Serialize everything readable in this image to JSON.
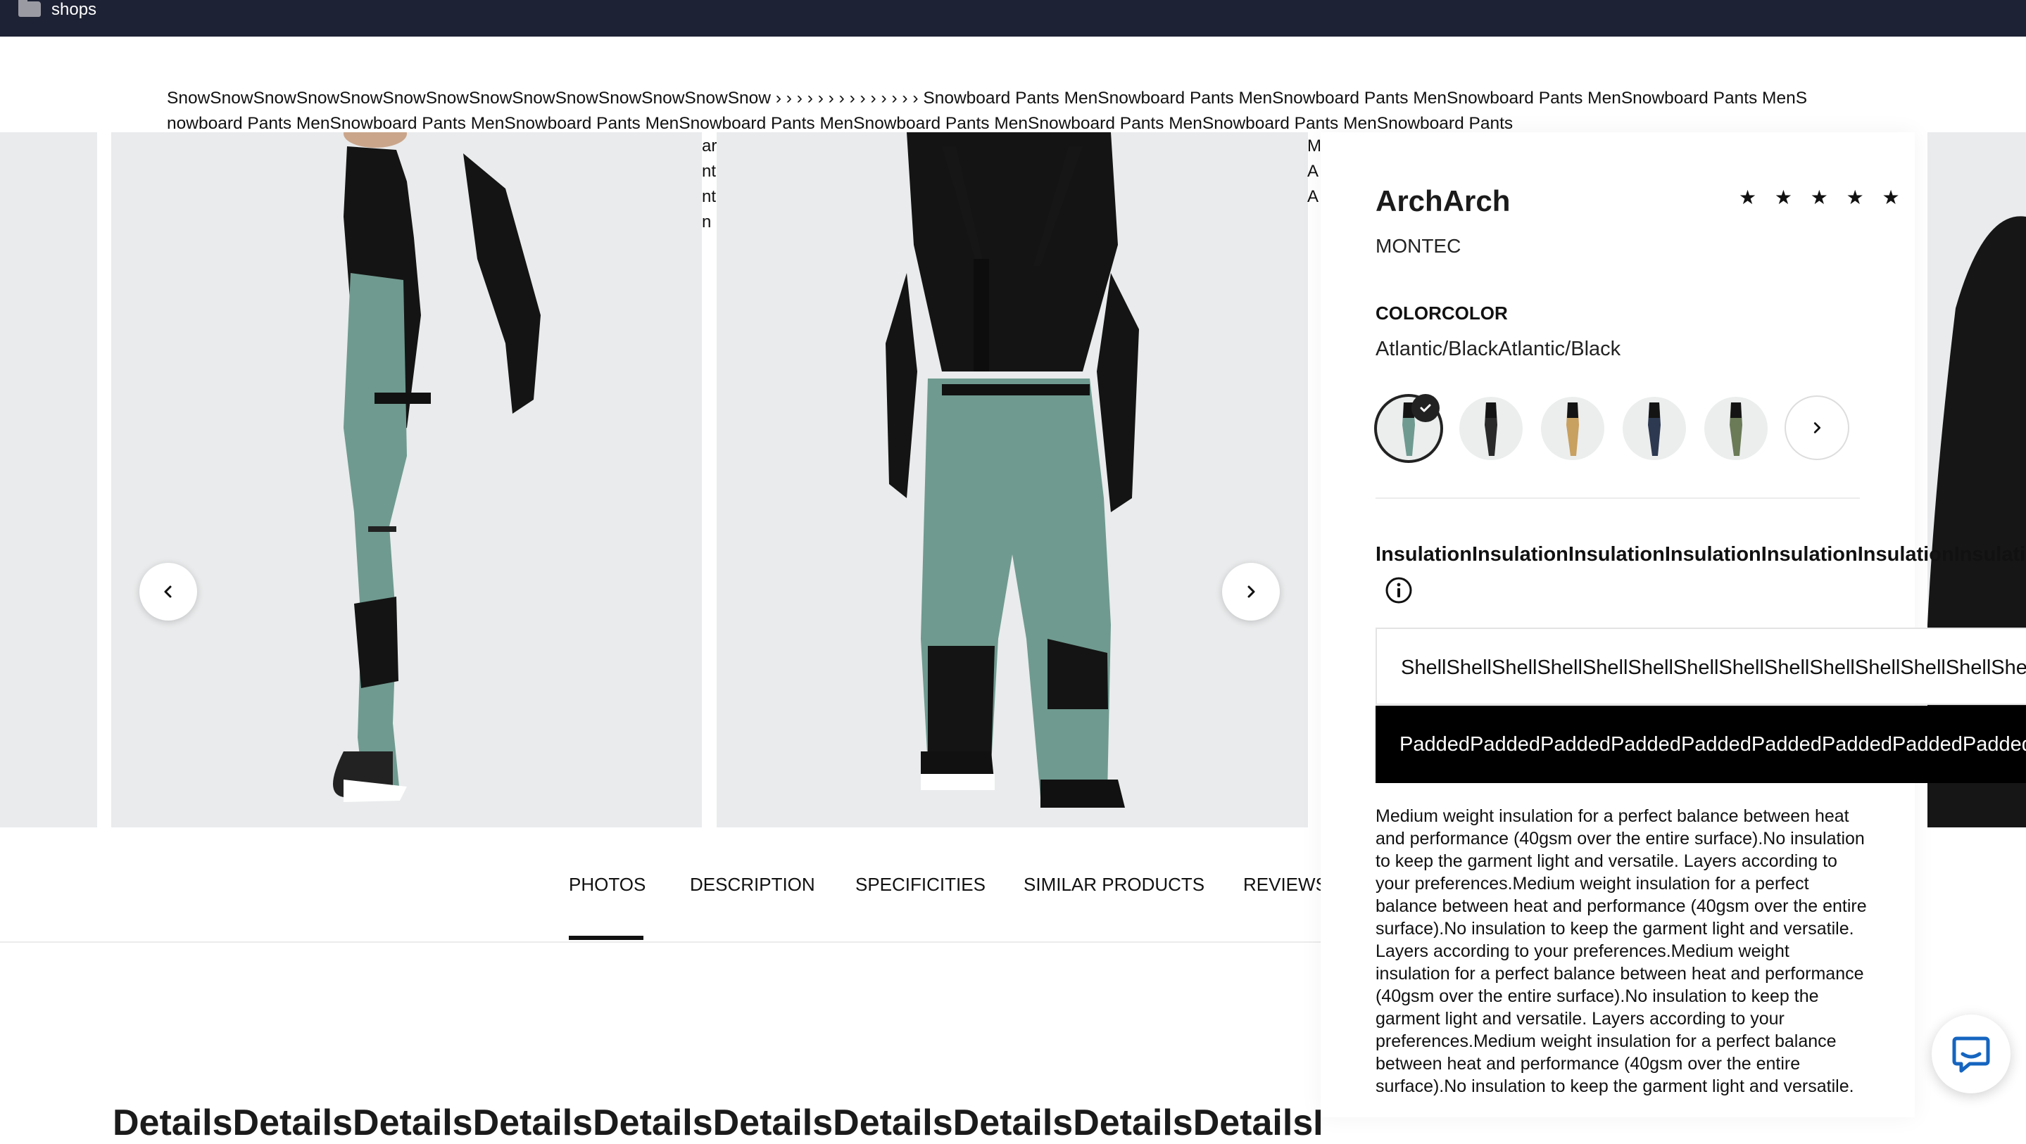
{
  "window": {
    "title": "shops"
  },
  "breadcrumb": {
    "category": "SnowSnowSnowSnowSnowSnowSnowSnowSnowSnowSnowSnowSnowSnow",
    "separators": "› › › › › › › › › › › › › ›",
    "current": "Snowboard Pants MenSnowboard Pants MenSnowboard Pants MenSnowboard Pants MenSnowboard Pants MenSnowboard Pants MenSnowboard Pants MenSnowboard Pants MenSnowboard Pants MenSnowboard Pants MenSnowboard Pants MenSnowboard Pants MenSnowboard Pants"
  },
  "gallery": {
    "overflow_a": "ar\nnt\nnt\nn",
    "overflow_b": "M\nA\nA"
  },
  "product": {
    "title": "ArchArch",
    "rating": 5,
    "stars": "★ ★ ★ ★ ★",
    "brand": "MONTEC",
    "color_label": "COLORCOLOR",
    "color_value": "Atlantic/BlackAtlantic/Black",
    "swatches": [
      {
        "color": "#6f9a8f",
        "selected": true
      },
      {
        "color": "#2a2a2a",
        "selected": false
      },
      {
        "color": "#c8a060",
        "selected": false
      },
      {
        "color": "#2d3950",
        "selected": false
      },
      {
        "color": "#6b7a57",
        "selected": false
      }
    ],
    "insulation_label": "InsulationInsulationInsulationInsulationInsulationInsulationInsulationInsulation",
    "options": {
      "shell": "ShellShellShellShellShellShellShellShellShellShellShellShellShellShellShell",
      "padded": "PaddedPaddedPaddedPaddedPaddedPaddedPaddedPaddedPaddedPaddedPadded"
    },
    "description": "Medium weight insulation for a perfect balance between heat and performance (40gsm over the entire surface).No insulation to keep the garment light and versatile. Layers according to your preferences.Medium weight insulation for a perfect balance between heat and performance (40gsm over the entire surface).No insulation to keep the garment light and versatile. Layers according to your preferences.Medium weight insulation for a perfect balance between heat and performance (40gsm over the entire surface).No insulation to keep the garment light and versatile. Layers according to your preferences.Medium weight insulation for a perfect balance between heat and performance (40gsm over the entire surface).No insulation to keep the garment light and versatile."
  },
  "tabs": [
    "PHOTOS",
    "DESCRIPTION",
    "SPECIFICITIES",
    "SIMILAR PRODUCTS",
    "REVIEWS"
  ],
  "details_heading": "DetailsDetailsDetailsDetailsDetailsDetailsDetailsDetailsDetailsDetailsDetails",
  "colors": {
    "topbar": "#1d2234",
    "chat_accent": "#1565c0",
    "pants_teal": "#6f9a8f",
    "photo_bg": "#e9ebec"
  }
}
